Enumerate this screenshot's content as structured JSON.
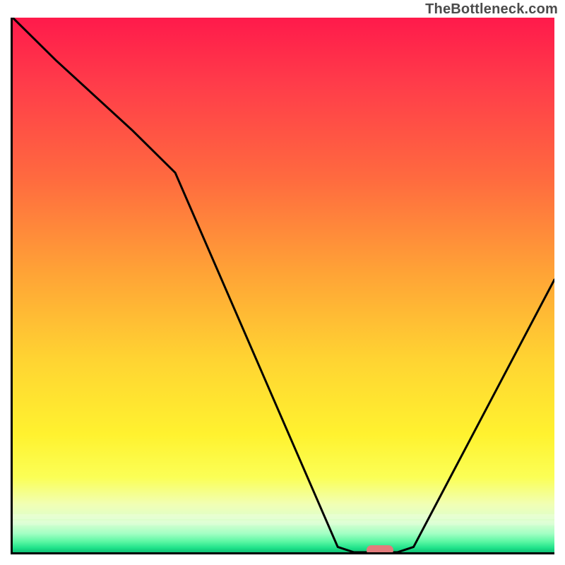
{
  "watermark": "TheBottleneck.com",
  "chart_data": {
    "type": "line",
    "title": "",
    "xlabel": "",
    "ylabel": "",
    "xlim": [
      0,
      100
    ],
    "ylim": [
      0,
      100
    ],
    "grid": false,
    "legend": false,
    "background_gradient": {
      "stops": [
        {
          "pos": 0,
          "color": "#ff1a4b"
        },
        {
          "pos": 0.12,
          "color": "#ff3b4a"
        },
        {
          "pos": 0.3,
          "color": "#ff6a3f"
        },
        {
          "pos": 0.48,
          "color": "#ffa436"
        },
        {
          "pos": 0.64,
          "color": "#ffd432"
        },
        {
          "pos": 0.78,
          "color": "#fff22f"
        },
        {
          "pos": 0.86,
          "color": "#fbff56"
        },
        {
          "pos": 0.91,
          "color": "#f1ffb4"
        },
        {
          "pos": 0.945,
          "color": "#d9ffd0"
        },
        {
          "pos": 0.965,
          "color": "#a2ffc4"
        },
        {
          "pos": 0.98,
          "color": "#5bf7a3"
        },
        {
          "pos": 0.992,
          "color": "#1fe28a"
        },
        {
          "pos": 1.0,
          "color": "#0fbf74"
        }
      ]
    },
    "series": [
      {
        "name": "bottleneck-curve",
        "color": "#000000",
        "x": [
          0,
          8,
          22,
          30,
          60,
          63,
          71,
          74,
          100
        ],
        "y": [
          100,
          92,
          79,
          71,
          1,
          0,
          0,
          1,
          51
        ]
      }
    ],
    "marker": {
      "name": "optimal-range",
      "color": "#e37b7c",
      "shape": "pill",
      "x_center": 67.5,
      "y_center": 0.8,
      "width_x": 5.0,
      "height_y": 1.8
    }
  }
}
